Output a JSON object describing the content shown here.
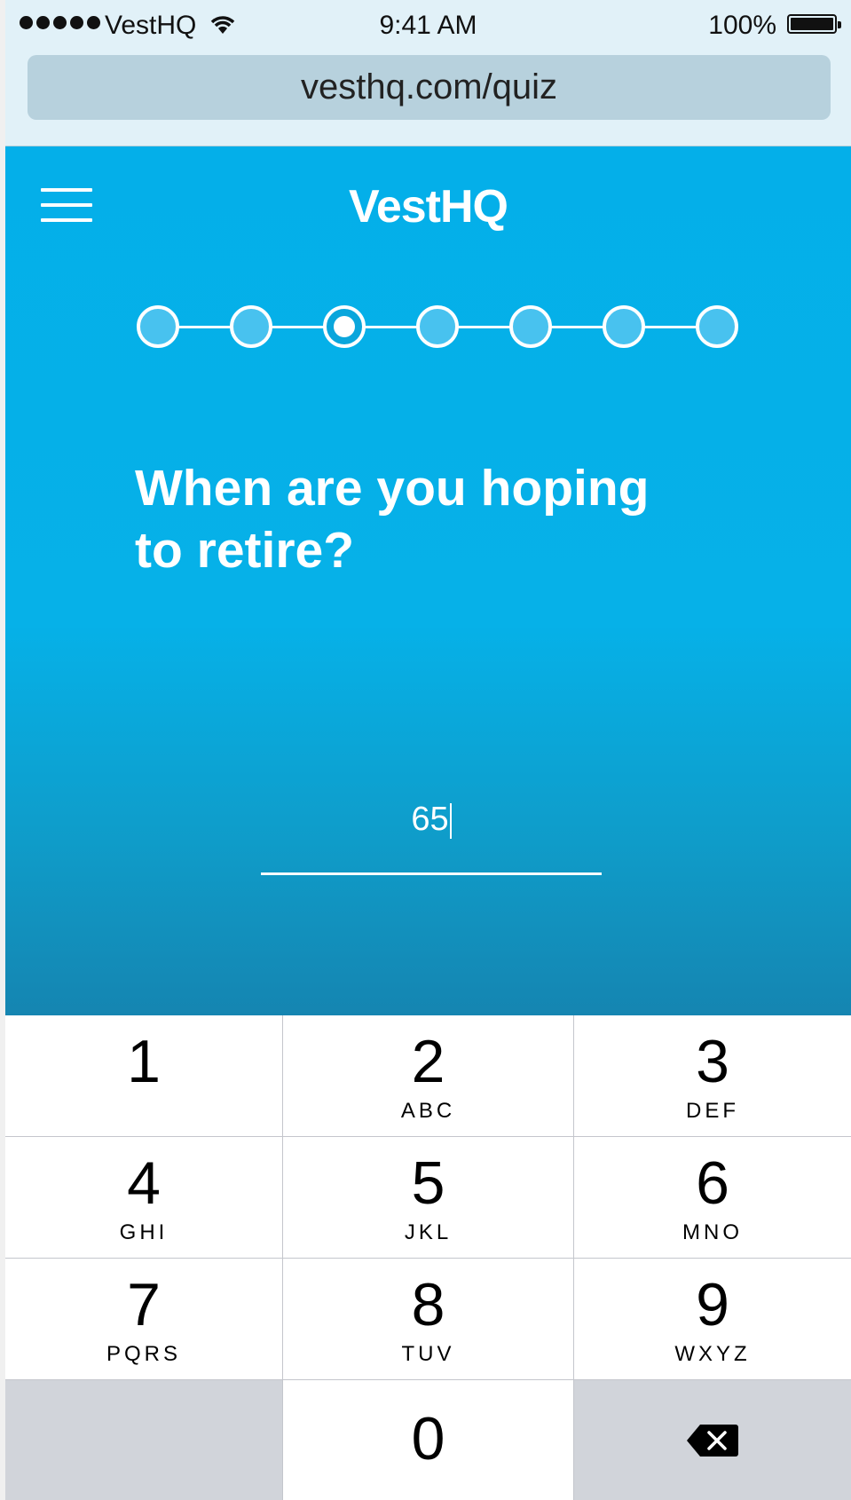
{
  "status_bar": {
    "carrier": "VestHQ",
    "time": "9:41 AM",
    "battery": "100%"
  },
  "browser": {
    "url": "vesthq.com/quiz"
  },
  "header": {
    "brand": "VestHQ",
    "menu_icon": "hamburger-icon"
  },
  "progress": {
    "total_steps": 7,
    "current_step": 3
  },
  "quiz": {
    "question": "When are you hoping to retire?",
    "answer_value": "65"
  },
  "keypad": {
    "keys": [
      {
        "digit": "1",
        "letters": ""
      },
      {
        "digit": "2",
        "letters": "ABC"
      },
      {
        "digit": "3",
        "letters": "DEF"
      },
      {
        "digit": "4",
        "letters": "GHI"
      },
      {
        "digit": "5",
        "letters": "JKL"
      },
      {
        "digit": "6",
        "letters": "MNO"
      },
      {
        "digit": "7",
        "letters": "PQRS"
      },
      {
        "digit": "8",
        "letters": "TUV"
      },
      {
        "digit": "9",
        "letters": "WXYZ"
      },
      {
        "digit": "0",
        "letters": ""
      }
    ],
    "delete_icon": "backspace-icon"
  },
  "colors": {
    "brand_blue": "#04afe9",
    "keypad_dark": "#d1d4da"
  }
}
